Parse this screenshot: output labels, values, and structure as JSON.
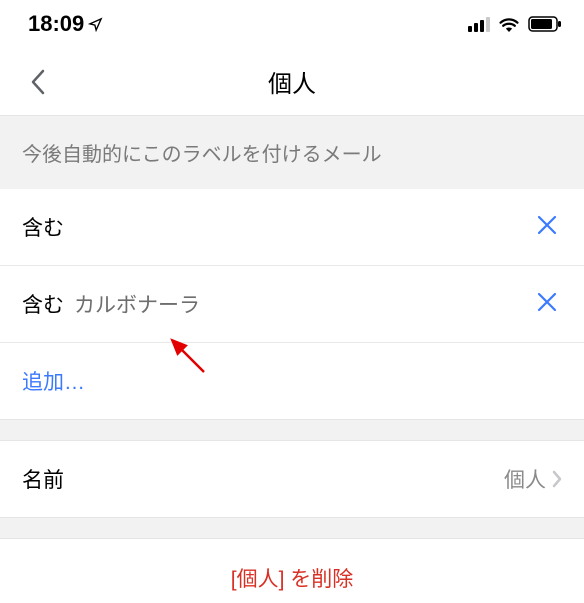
{
  "statusBar": {
    "time": "18:09"
  },
  "nav": {
    "title": "個人"
  },
  "sectionHeader": "今後自動的にこのラベルを付けるメール",
  "filters": [
    {
      "label": "含む",
      "value": ""
    },
    {
      "label": "含む",
      "value": "カルボナーラ"
    }
  ],
  "addLabel": "追加…",
  "nameRow": {
    "label": "名前",
    "value": "個人"
  },
  "deleteLabel": "[個人] を削除"
}
